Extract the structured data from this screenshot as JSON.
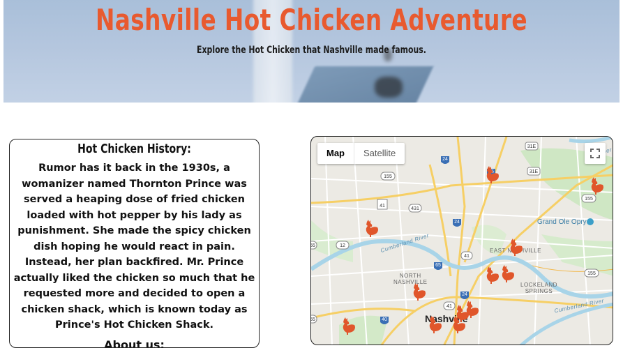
{
  "header": {
    "title": "Nashville Hot Chicken Adventure",
    "subtitle": "Explore the Hot Chicken that Nashville made famous."
  },
  "history": {
    "heading": "Hot Chicken History:",
    "body": "Rumor has it back in the 1930s, a womanizer named Thornton Prince was served a heaping dose of fried chicken loaded with hot pepper by his lady as punishment. She made the spicy chicken dish hoping he would react in pain. Instead, her plan backfired. Mr. Prince actually liked the chicken so much that he requested more and decided to open a chicken shack, which is known today as Prince's Hot Chicken Shack.",
    "about_heading": "About us:"
  },
  "map": {
    "type_map": "Map",
    "type_satellite": "Satellite",
    "labels": {
      "nashville": "Nashville",
      "opry": "Grand Ole Opry",
      "north_nashville": "NORTH\nNASHVILLE",
      "east_nashville": "EAST NASHVILLE",
      "lockeland": "LOCKELAND\nSPRINGS",
      "cumberland_river": "Cumberland River",
      "cumberland_river2": "Cumberland River",
      "cumberland_top": "Cumber"
    },
    "shields": [
      "31E",
      "24",
      "155",
      "65",
      "31E",
      "41",
      "431",
      "155",
      "24",
      "12",
      "55",
      "41",
      "65",
      "155",
      "24",
      "41",
      "40",
      "55"
    ],
    "pin_count": 12
  },
  "colors": {
    "title": "#e85a2f",
    "pin": "#e0562b",
    "banner": "#b4c6de"
  }
}
